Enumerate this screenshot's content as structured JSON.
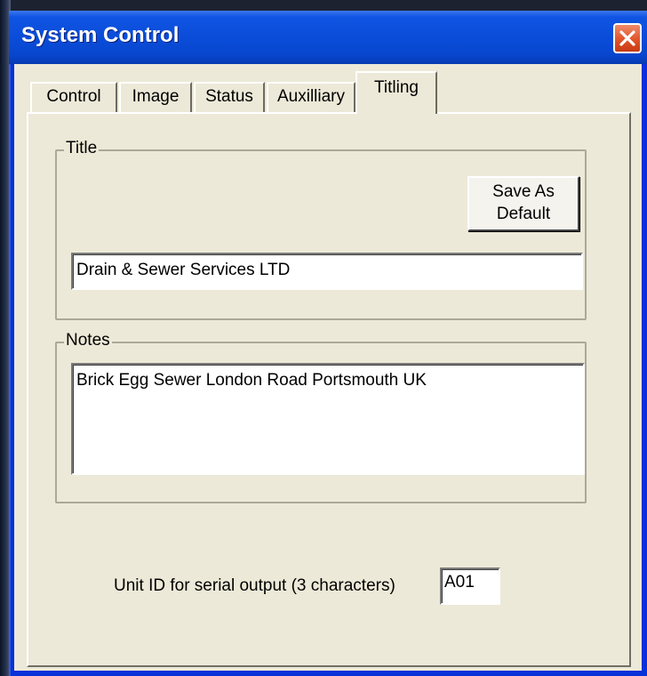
{
  "window": {
    "title": "System Control"
  },
  "tabs": [
    {
      "label": "Control"
    },
    {
      "label": "Image"
    },
    {
      "label": "Status"
    },
    {
      "label": "Auxilliary"
    },
    {
      "label": "Titling"
    }
  ],
  "active_tab": "Titling",
  "title_group": {
    "label": "Title",
    "save_button_line1": "Save As",
    "save_button_line2": "Default",
    "value": "Drain & Sewer Services LTD"
  },
  "notes_group": {
    "label": "Notes",
    "value": "Brick Egg Sewer London Road Portsmouth UK"
  },
  "unit_id": {
    "label": "Unit ID for serial output (3 characters)",
    "value": "A01"
  },
  "colors": {
    "titlebar": "#0a4cd8",
    "dialog_face": "#ece9d8",
    "close_button": "#e2542a"
  },
  "icons": {
    "close": "close-icon"
  }
}
